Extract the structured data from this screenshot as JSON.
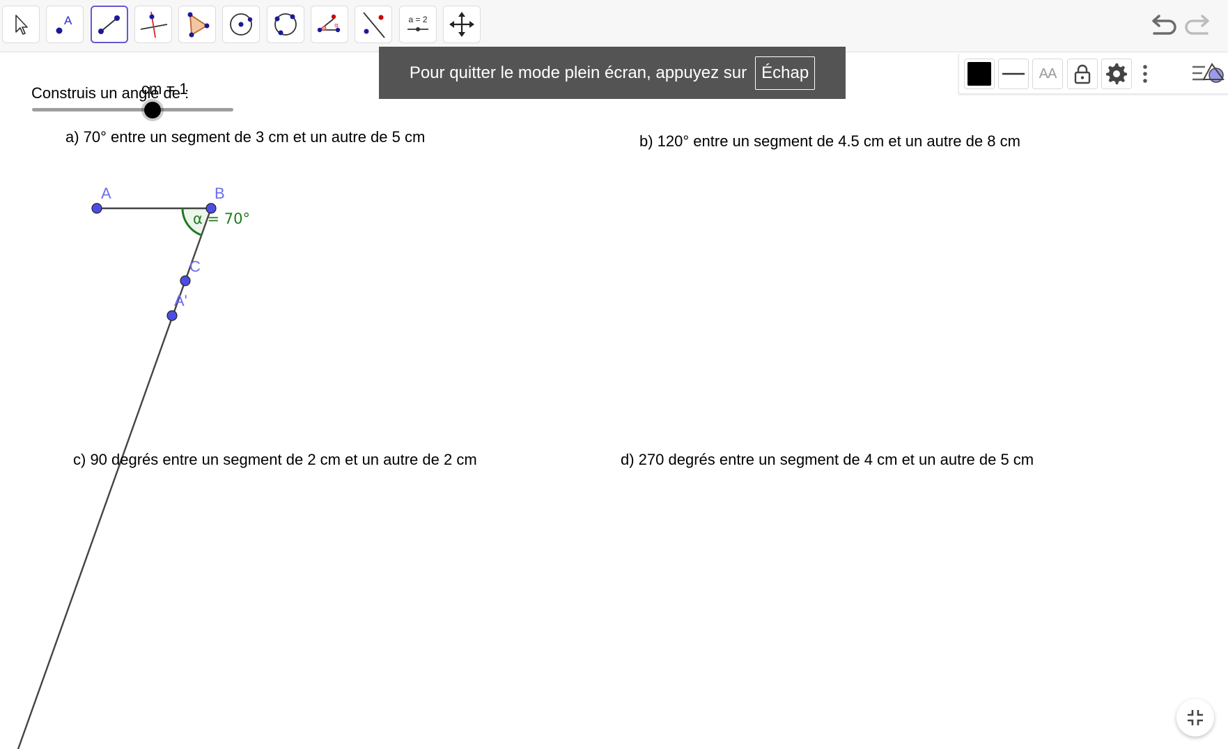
{
  "toolbar": {
    "tools": [
      "move",
      "point",
      "segment",
      "perpendicular-line",
      "polygon",
      "circle-center-point",
      "circle-three-points",
      "angle",
      "reflect-about-line",
      "slider",
      "move-graphics-view"
    ],
    "selected_tool": "segment",
    "slider_tool_label": "a = 2"
  },
  "fullscreen_toast": {
    "message": "Pour quitter le mode plein écran, appuyez sur",
    "key": "Échap"
  },
  "style_bar": {
    "color": "#000000",
    "text_size_label": "AA"
  },
  "canvas": {
    "instruction": "Construis un angle de :",
    "slider_label": "cm = 1",
    "slider_fraction": 0.6,
    "task_a": "a) 70° entre un segment de 3 cm et un autre de 5 cm",
    "task_b": "b) 120° entre un segment de 4.5 cm et un autre de 8 cm",
    "task_c": "c) 90 degrés entre un segment de 2 cm et un autre de 2 cm",
    "task_d": "d) 270 degrés entre un segment de 4 cm et un autre de 5 cm",
    "points": {
      "A": "A",
      "B": "B",
      "C": "C",
      "A_prime": "A'"
    },
    "angle_label": "α = 70°",
    "colors": {
      "point": "#4d4de6",
      "point_label": "#6b6bf0",
      "angle": "#1f7a1f",
      "segment": "#444444",
      "toolbar_selected": "#6557d2"
    }
  }
}
